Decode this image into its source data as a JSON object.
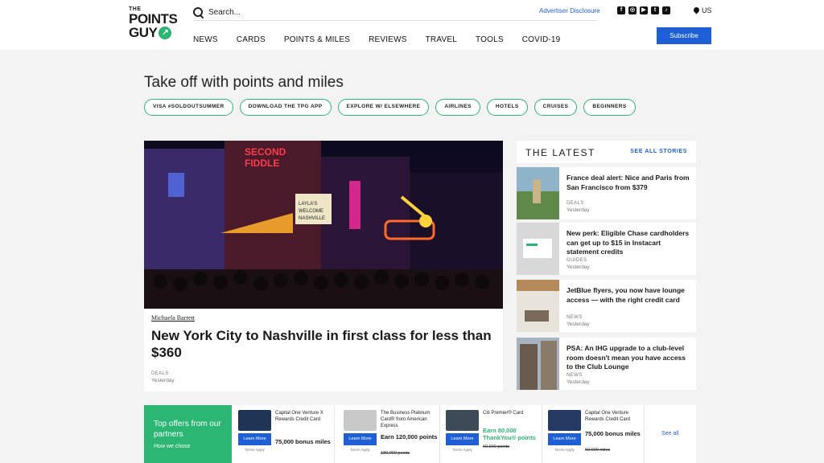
{
  "logo": {
    "line1": "THE",
    "line2": "POINTS",
    "line3": "GUY"
  },
  "search": {
    "placeholder": "Search..."
  },
  "header": {
    "advertiser": "Advertiser Disclosure",
    "locale": "US",
    "subscribe": "Subscribe"
  },
  "social": [
    "facebook-icon",
    "instagram-icon",
    "youtube-icon",
    "twitter-icon",
    "tiktok-icon"
  ],
  "nav": [
    "NEWS",
    "CARDS",
    "POINTS & MILES",
    "REVIEWS",
    "TRAVEL",
    "TOOLS",
    "COVID-19"
  ],
  "hero": {
    "title": "Take off with points and miles",
    "chips": [
      "VISA #SOLDOUTSUMMER",
      "DOWNLOAD THE TPG APP",
      "EXPLORE W/ ELSEWHERE",
      "AIRLINES",
      "HOTELS",
      "CRUISES",
      "BEGINNERS"
    ]
  },
  "feature": {
    "author": "Michaela Barrett",
    "title": "New York City to Nashville in first class for less than $360",
    "category": "DEALS",
    "time": "Yesterday"
  },
  "latest": {
    "title": "THE LATEST",
    "see_all": "SEE ALL STORIES",
    "stories": [
      {
        "title": "France deal alert: Nice and Paris from San Francisco from $379",
        "category": "DEALS",
        "time": "Yesterday"
      },
      {
        "title": "New perk: Eligible Chase cardholders can get up to $15 in Instacart statement credits",
        "category": "GUIDES",
        "time": "Yesterday"
      },
      {
        "title": "JetBlue flyers, you now have lounge access — with the right credit card",
        "category": "NEWS",
        "time": "Yesterday"
      },
      {
        "title": "PSA: An IHG upgrade to a club-level room doesn't mean you have access to the Club Lounge",
        "category": "NEWS",
        "time": "Yesterday"
      }
    ]
  },
  "offers": {
    "title": "Top offers from our partners",
    "how": "How we chose",
    "see_all": "See all",
    "items": [
      {
        "name": "Capital One Venture X Rewards Credit Card",
        "value": "75,000 bonus miles",
        "old": "",
        "learn": "Learn More",
        "terms": "Terms Apply",
        "card_color": "#1f3556",
        "value_color": "#111111"
      },
      {
        "name": "The Business Platinum Card® from American Express",
        "value": "Earn 120,000 points",
        "old": "180,000 points",
        "learn": "Learn More",
        "terms": "Terms Apply",
        "card_color": "#c9c9c9",
        "value_color": "#111111"
      },
      {
        "name": "Citi Premier® Card",
        "value": "Earn 80,000 ThankYou® points",
        "old": "60,000 points",
        "learn": "Learn More",
        "terms": "Terms Apply",
        "card_color": "#3d4a57",
        "value_color": "#2bb673"
      },
      {
        "name": "Capital One Venture Rewards Credit Card",
        "value": "75,000 bonus miles",
        "old": "60,000 miles",
        "learn": "Learn More",
        "terms": "Terms Apply",
        "card_color": "#243a63",
        "value_color": "#111111"
      }
    ]
  },
  "colors": {
    "accent": "#2bb673",
    "link": "#1e5fd6"
  }
}
